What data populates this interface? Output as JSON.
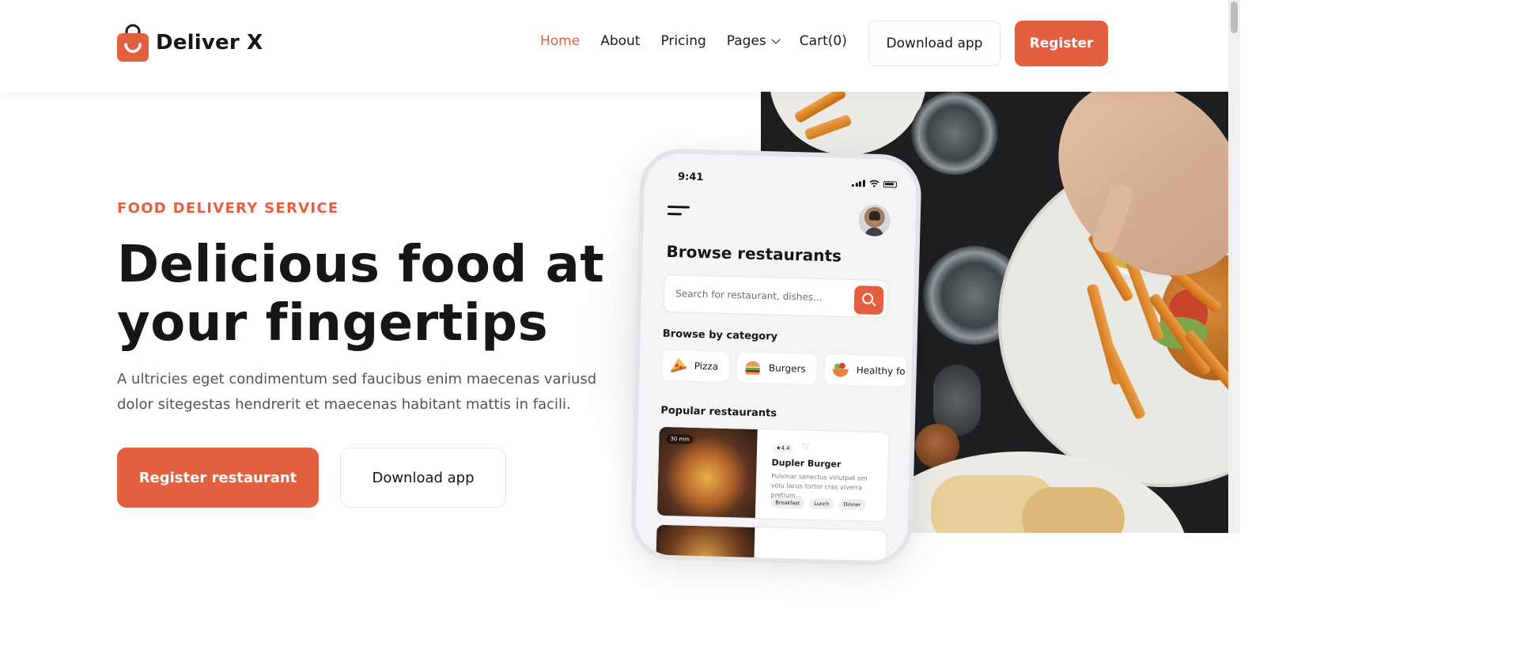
{
  "brand": {
    "name": "Deliver X",
    "color": "#e2603f"
  },
  "nav": {
    "items": [
      {
        "label": "Home",
        "active": true
      },
      {
        "label": "About"
      },
      {
        "label": "Pricing"
      },
      {
        "label": "Pages",
        "has_dropdown": true
      },
      {
        "label": "Cart(0)"
      }
    ],
    "download_label": "Download app",
    "register_label": "Register"
  },
  "hero": {
    "eyebrow": "FOOD DELIVERY SERVICE",
    "headline": "Delicious food at your fingertips",
    "subtext": "A ultricies eget condimentum sed faucibus enim maecenas variusd dolor sitegestas hendrerit et maecenas habitant mattis in facili.",
    "primary_cta": "Register restaurant",
    "secondary_cta": "Download app"
  },
  "phone": {
    "time": "9:41",
    "title": "Browse restaurants",
    "search_placeholder": "Search for restaurant, dishes...",
    "category_title": "Browse by category",
    "categories": [
      {
        "label": "Pizza",
        "icon": "pizza-icon",
        "color": "#e88b3a"
      },
      {
        "label": "Burgers",
        "icon": "burger-icon",
        "color": "#d99a3e"
      },
      {
        "label": "Healthy fo",
        "icon": "salad-icon",
        "color": "#e0602e"
      }
    ],
    "popular_title": "Popular restaurants",
    "restaurant": {
      "time_badge": "30 min",
      "rating": "★4.4",
      "name": "Dupler Burger",
      "description": "Pulvinar senectus volutpat om volu lacus tortor cras viverra pretium...",
      "tags": [
        "Breakfast",
        "Lunch",
        "Dinner"
      ]
    }
  }
}
